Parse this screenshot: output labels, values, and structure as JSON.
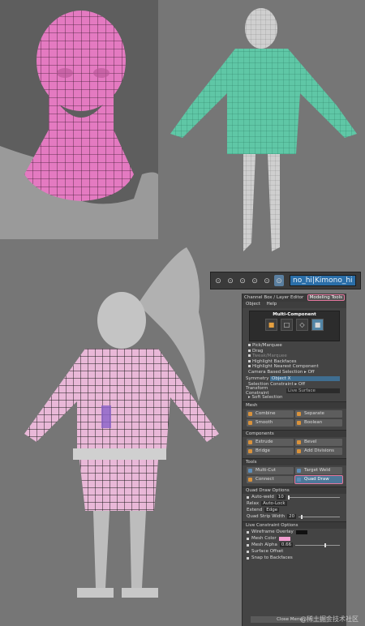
{
  "snap_toolbar": {
    "buttons": [
      "⊙",
      "⊙",
      "⊙",
      "⊙",
      "⊙",
      "⊙"
    ],
    "object_name": "no_hi|Kimono_hi"
  },
  "tools_panel": {
    "tab_left": "Channel Box / Layer Editor",
    "tab_active": "Modeling Tools",
    "menu": [
      "Object",
      "Help"
    ],
    "multi_component_title": "Multi-Component",
    "pick_options": [
      "Pick/Marquee",
      "Drag",
      "Tweak/Marquee",
      "Highlight Backfaces",
      "Highlight Nearest Component"
    ],
    "camera_based_selection": "Camera Based Selection",
    "camera_based_value": "Off",
    "symmetry_label": "Symmetry",
    "symmetry_value": "Object X",
    "selection_constraint_label": "Selection Constraint",
    "selection_constraint_value": "Off",
    "transform_constraint_label": "Transform Constraint",
    "transform_constraint_value": "Live Surface",
    "soft_selection": "Soft Selection",
    "mesh_header": "Mesh",
    "mesh_buttons": [
      "Combine",
      "Separate",
      "Smooth",
      "Boolean"
    ],
    "components_header": "Components",
    "component_buttons": [
      "Extrude",
      "Bevel",
      "Bridge",
      "Add Divisions"
    ],
    "tools_header": "Tools",
    "tool_multicut": "Multi-Cut",
    "tool_target_weld": "Target Weld",
    "tool_connect": "Connect",
    "tool_quad_draw": "Quad Draw",
    "quad_draw_options": "Quad Draw Options",
    "auto_weld_label": "Auto-weld",
    "auto_weld_value": "10",
    "relax_label": "Relax",
    "relax_value": "Auto-Lock",
    "extend_label": "Extend",
    "extend_value": "Edge",
    "strip_width_label": "Quad Strip Width",
    "strip_width_value": "20",
    "live_constraint_options": "Live Constraint Options",
    "wireframe_overlay": "Wireframe Overlay",
    "mesh_color": "Mesh Color",
    "mesh_alpha_label": "Mesh Alpha",
    "mesh_alpha_value": "0.66",
    "mesh_alpha_level": 0.66,
    "surface_offset": "Surface Offset",
    "snap_to_backfaces": "Snap to Backfaces",
    "close_button": "Close Menu",
    "colors": {
      "mesh_pink": "#f29ed1",
      "highlight": "#e5779e",
      "selected_field": "#3f6e91"
    }
  },
  "watermark": "@稀土掘金技术社区"
}
